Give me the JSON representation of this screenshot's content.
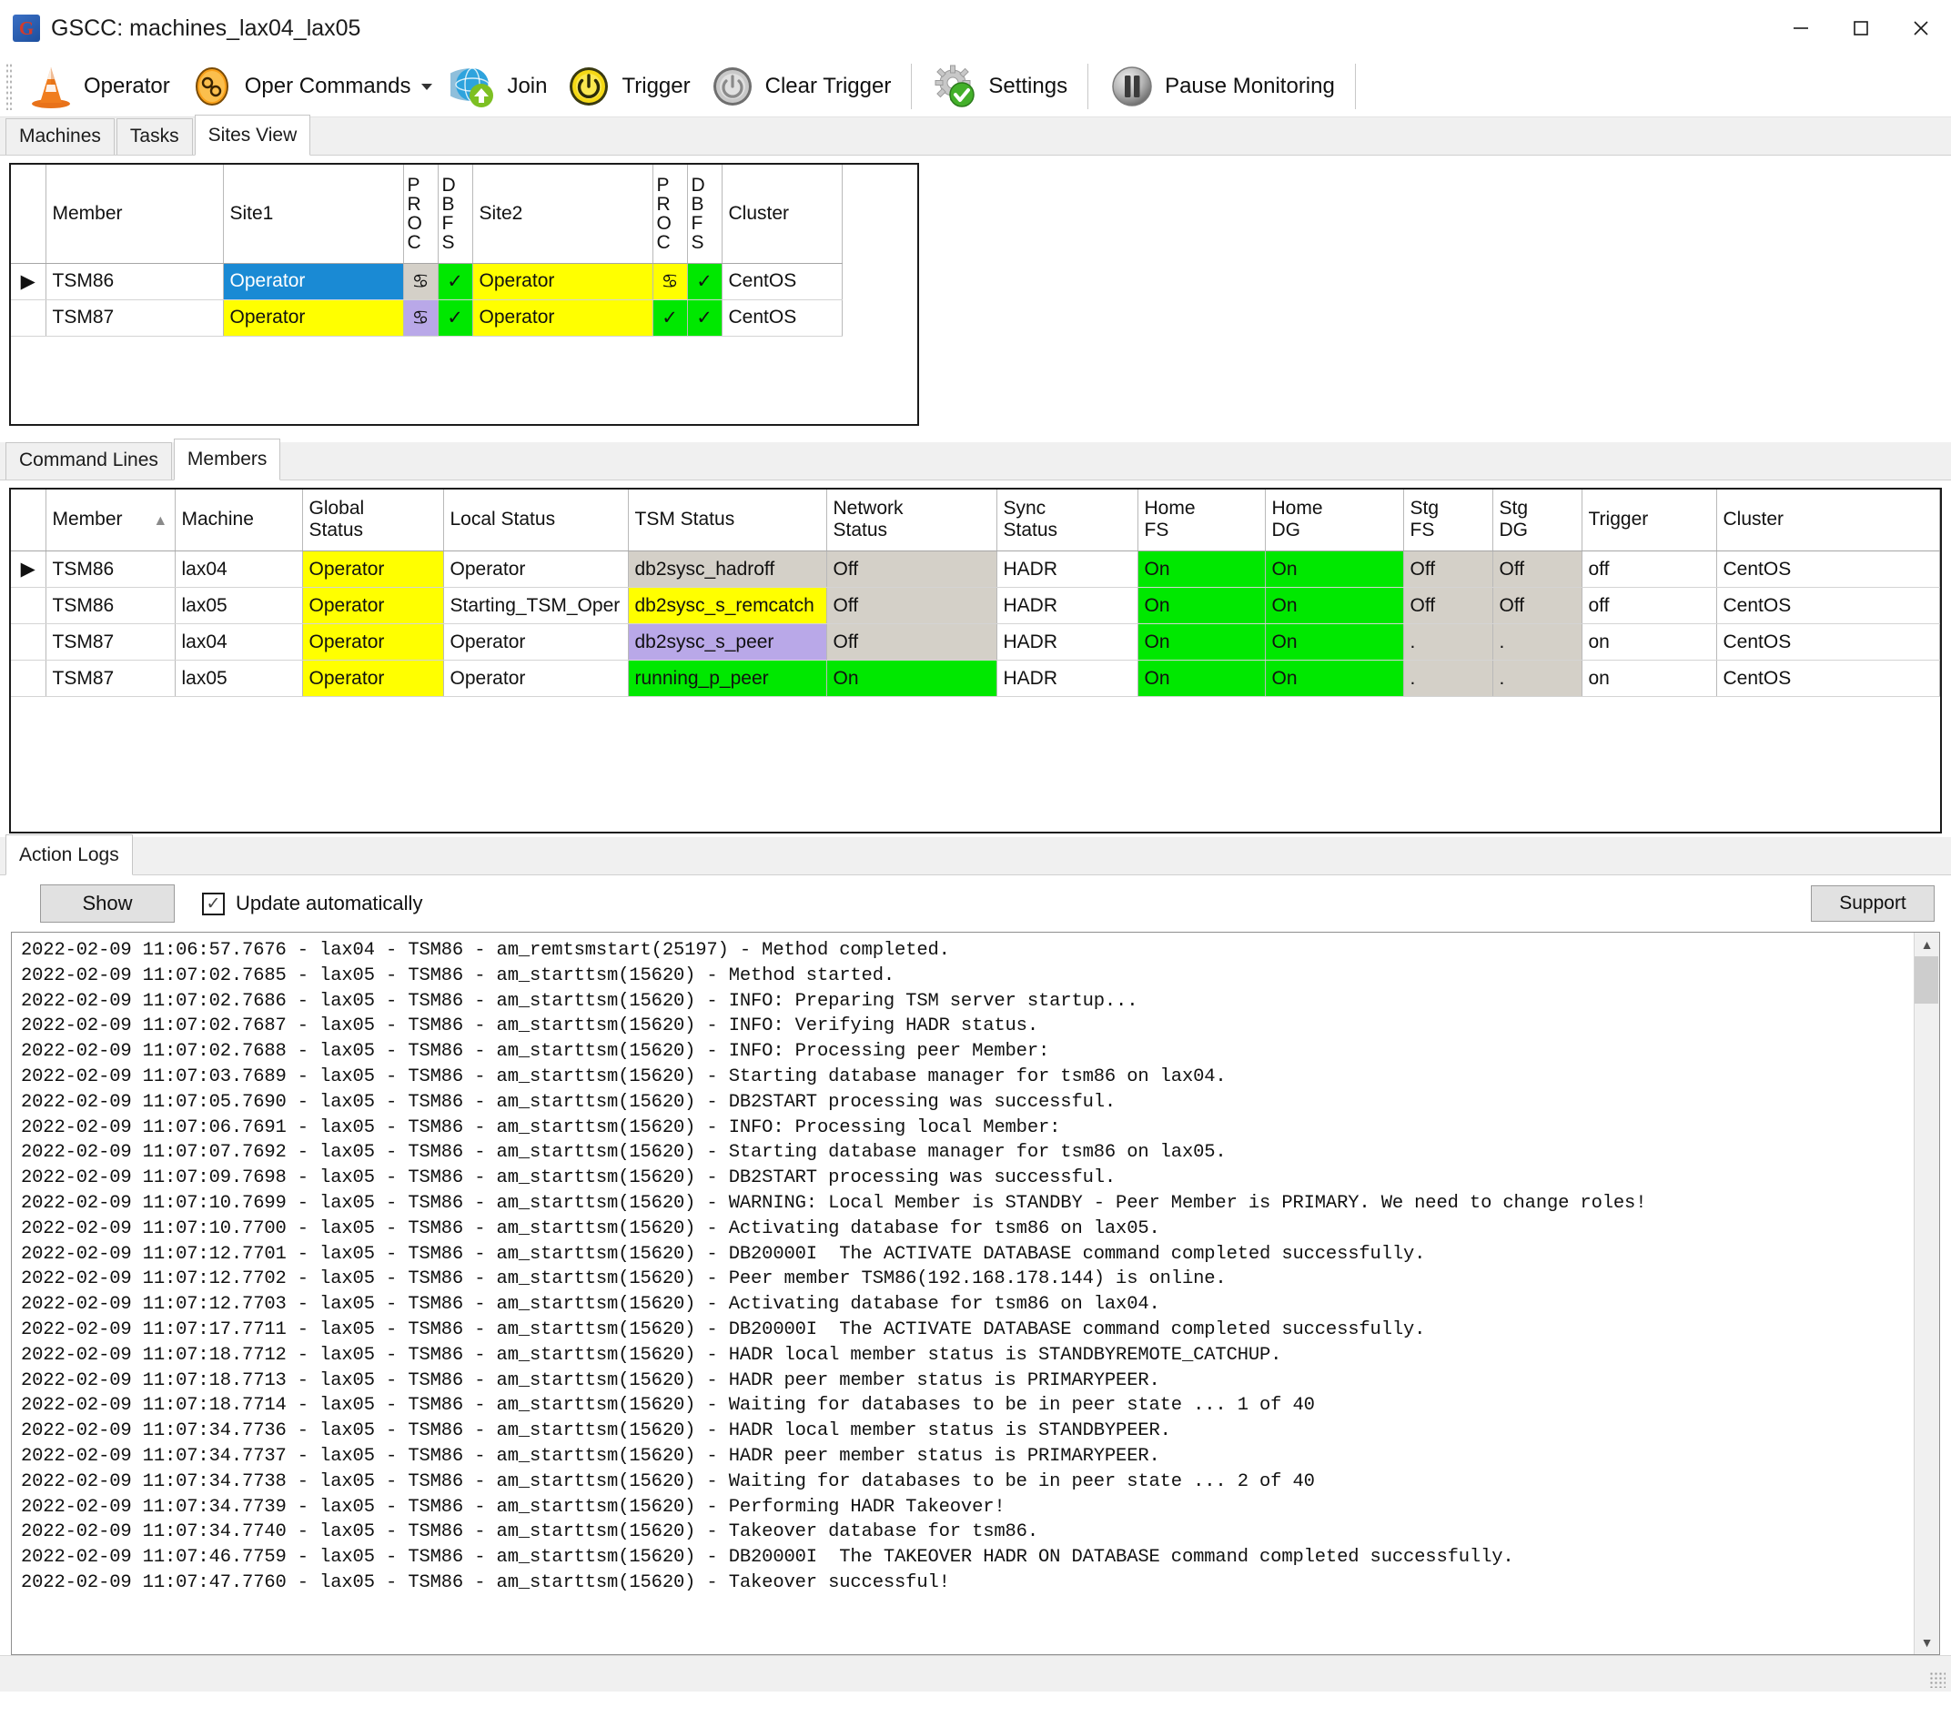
{
  "window": {
    "title": "GSCC: machines_lax04_lax05",
    "app_icon": "G",
    "minimize": "minimize-icon",
    "maximize": "maximize-icon",
    "close": "close-icon"
  },
  "toolbar": {
    "items": [
      {
        "label": "Operator",
        "icon": "traffic-cone-icon",
        "dropdown": false
      },
      {
        "label": "Oper Commands",
        "icon": "gear-links-icon",
        "dropdown": true
      },
      {
        "label": "Join",
        "icon": "globe-join-icon",
        "dropdown": false
      },
      {
        "label": "Trigger",
        "icon": "power-yellow-icon",
        "dropdown": false
      },
      {
        "label": "Clear Trigger",
        "icon": "power-gray-icon",
        "dropdown": false
      },
      {
        "label": "Settings",
        "icon": "gear-check-icon",
        "dropdown": false
      },
      {
        "label": "Pause Monitoring",
        "icon": "pause-icon",
        "dropdown": false
      }
    ]
  },
  "top_tabs": {
    "items": [
      "Machines",
      "Tasks",
      "Sites View"
    ],
    "active": "Sites View"
  },
  "sites_grid": {
    "columns": [
      "",
      "Member",
      "Site1",
      "PROC",
      "DBFS",
      "Site2",
      "PROC",
      "DBFS",
      "Cluster"
    ],
    "vertical_headers": {
      "proc": "PROC",
      "dbfs": "DBFS"
    },
    "rows": [
      {
        "selector": "▶",
        "member": "TSM86",
        "site1": "Operator",
        "site1_color": "#1a8ad4",
        "site1_proc": "♋",
        "site1_proc_color": "#d4d0c8",
        "site1_dbfs": "✓",
        "site1_dbfs_color": "#00e800",
        "site2": "Operator",
        "site2_color": "#ffff00",
        "site2_proc": "♋",
        "site2_proc_color": "#ffff00",
        "site2_dbfs": "✓",
        "site2_dbfs_color": "#00e800",
        "cluster": "CentOS"
      },
      {
        "selector": "",
        "member": "TSM87",
        "site1": "Operator",
        "site1_color": "#ffff00",
        "site1_proc": "♋",
        "site1_proc_color": "#b9a8e8",
        "site1_dbfs": "✓",
        "site1_dbfs_color": "#00e800",
        "site2": "Operator",
        "site2_color": "#ffff00",
        "site2_proc": "✓",
        "site2_proc_color": "#00e800",
        "site2_dbfs": "✓",
        "site2_dbfs_color": "#00e800",
        "cluster": "CentOS"
      }
    ]
  },
  "middle_tabs": {
    "items": [
      "Command Lines",
      "Members"
    ],
    "active": "Members"
  },
  "members_grid": {
    "columns": [
      "",
      "Member",
      "Machine",
      "Global Status",
      "Local Status",
      "TSM Status",
      "Network Status",
      "Sync Status",
      "Home FS",
      "Home DG",
      "Stg FS",
      "Stg DG",
      "Trigger",
      "Cluster"
    ],
    "sort_column": "Member",
    "sort_direction": "ascending",
    "rows": [
      {
        "selector": "▶",
        "member": "TSM86",
        "machine": "lax04",
        "global_status": "Operator",
        "global_color": "#ffff00",
        "local_status": "Operator",
        "local_color": "#ffffff",
        "tsm_status": "db2sysc_hadroff",
        "tsm_color": "#d4d0c8",
        "network_status": "Off",
        "network_color": "#d4d0c8",
        "sync_status": "HADR",
        "sync_color": "#ffffff",
        "home_fs": "On",
        "home_fs_color": "#00e800",
        "home_dg": "On",
        "home_dg_color": "#00e800",
        "stg_fs": "Off",
        "stg_fs_color": "#d4d0c8",
        "stg_dg": "Off",
        "stg_dg_color": "#d4d0c8",
        "trigger": "off",
        "trigger_color": "#ffffff",
        "cluster": "CentOS"
      },
      {
        "selector": "",
        "member": "TSM86",
        "machine": "lax05",
        "global_status": "Operator",
        "global_color": "#ffff00",
        "local_status": "Starting_TSM_Oper",
        "local_color": "#ffffff",
        "tsm_status": "db2sysc_s_remcatch",
        "tsm_color": "#ffff00",
        "network_status": "Off",
        "network_color": "#d4d0c8",
        "sync_status": "HADR",
        "sync_color": "#ffffff",
        "home_fs": "On",
        "home_fs_color": "#00e800",
        "home_dg": "On",
        "home_dg_color": "#00e800",
        "stg_fs": "Off",
        "stg_fs_color": "#d4d0c8",
        "stg_dg": "Off",
        "stg_dg_color": "#d4d0c8",
        "trigger": "off",
        "trigger_color": "#ffffff",
        "cluster": "CentOS"
      },
      {
        "selector": "",
        "member": "TSM87",
        "machine": "lax04",
        "global_status": "Operator",
        "global_color": "#ffff00",
        "local_status": "Operator",
        "local_color": "#ffffff",
        "tsm_status": "db2sysc_s_peer",
        "tsm_color": "#b9a8e8",
        "network_status": "Off",
        "network_color": "#d4d0c8",
        "sync_status": "HADR",
        "sync_color": "#ffffff",
        "home_fs": "On",
        "home_fs_color": "#00e800",
        "home_dg": "On",
        "home_dg_color": "#00e800",
        "stg_fs": ".",
        "stg_fs_color": "#d4d0c8",
        "stg_dg": ".",
        "stg_dg_color": "#d4d0c8",
        "trigger": "on",
        "trigger_color": "#ffffff",
        "cluster": "CentOS"
      },
      {
        "selector": "",
        "member": "TSM87",
        "machine": "lax05",
        "global_status": "Operator",
        "global_color": "#ffff00",
        "local_status": "Operator",
        "local_color": "#ffffff",
        "tsm_status": "running_p_peer",
        "tsm_color": "#00e800",
        "network_status": "On",
        "network_color": "#00e800",
        "sync_status": "HADR",
        "sync_color": "#ffffff",
        "home_fs": "On",
        "home_fs_color": "#00e800",
        "home_dg": "On",
        "home_dg_color": "#00e800",
        "stg_fs": ".",
        "stg_fs_color": "#d4d0c8",
        "stg_dg": ".",
        "stg_dg_color": "#d4d0c8",
        "trigger": "on",
        "trigger_color": "#ffffff",
        "cluster": "CentOS"
      }
    ]
  },
  "logs_tab": {
    "items": [
      "Action Logs"
    ],
    "active": "Action Logs"
  },
  "log_controls": {
    "show_label": "Show",
    "auto_update_label": "Update automatically",
    "auto_update_checked": true,
    "checkmark": "✓",
    "support_label": "Support"
  },
  "log_text": "2022-02-09 11:06:57.7676 - lax04 - TSM86 - am_remtsmstart(25197) - Method completed.\n2022-02-09 11:07:02.7685 - lax05 - TSM86 - am_starttsm(15620) - Method started.\n2022-02-09 11:07:02.7686 - lax05 - TSM86 - am_starttsm(15620) - INFO: Preparing TSM server startup...\n2022-02-09 11:07:02.7687 - lax05 - TSM86 - am_starttsm(15620) - INFO: Verifying HADR status.\n2022-02-09 11:07:02.7688 - lax05 - TSM86 - am_starttsm(15620) - INFO: Processing peer Member:\n2022-02-09 11:07:03.7689 - lax05 - TSM86 - am_starttsm(15620) - Starting database manager for tsm86 on lax04.\n2022-02-09 11:07:05.7690 - lax05 - TSM86 - am_starttsm(15620) - DB2START processing was successful.\n2022-02-09 11:07:06.7691 - lax05 - TSM86 - am_starttsm(15620) - INFO: Processing local Member:\n2022-02-09 11:07:07.7692 - lax05 - TSM86 - am_starttsm(15620) - Starting database manager for tsm86 on lax05.\n2022-02-09 11:07:09.7698 - lax05 - TSM86 - am_starttsm(15620) - DB2START processing was successful.\n2022-02-09 11:07:10.7699 - lax05 - TSM86 - am_starttsm(15620) - WARNING: Local Member is STANDBY - Peer Member is PRIMARY. We need to change roles!\n2022-02-09 11:07:10.7700 - lax05 - TSM86 - am_starttsm(15620) - Activating database for tsm86 on lax05.\n2022-02-09 11:07:12.7701 - lax05 - TSM86 - am_starttsm(15620) - DB20000I  The ACTIVATE DATABASE command completed successfully.\n2022-02-09 11:07:12.7702 - lax05 - TSM86 - am_starttsm(15620) - Peer member TSM86(192.168.178.144) is online.\n2022-02-09 11:07:12.7703 - lax05 - TSM86 - am_starttsm(15620) - Activating database for tsm86 on lax04.\n2022-02-09 11:07:17.7711 - lax05 - TSM86 - am_starttsm(15620) - DB20000I  The ACTIVATE DATABASE command completed successfully.\n2022-02-09 11:07:18.7712 - lax05 - TSM86 - am_starttsm(15620) - HADR local member status is STANDBYREMOTE_CATCHUP.\n2022-02-09 11:07:18.7713 - lax05 - TSM86 - am_starttsm(15620) - HADR peer member status is PRIMARYPEER.\n2022-02-09 11:07:18.7714 - lax05 - TSM86 - am_starttsm(15620) - Waiting for databases to be in peer state ... 1 of 40\n2022-02-09 11:07:34.7736 - lax05 - TSM86 - am_starttsm(15620) - HADR local member status is STANDBYPEER.\n2022-02-09 11:07:34.7737 - lax05 - TSM86 - am_starttsm(15620) - HADR peer member status is PRIMARYPEER.\n2022-02-09 11:07:34.7738 - lax05 - TSM86 - am_starttsm(15620) - Waiting for databases to be in peer state ... 2 of 40\n2022-02-09 11:07:34.7739 - lax05 - TSM86 - am_starttsm(15620) - Performing HADR Takeover!\n2022-02-09 11:07:34.7740 - lax05 - TSM86 - am_starttsm(15620) - Takeover database for tsm86.\n2022-02-09 11:07:46.7759 - lax05 - TSM86 - am_starttsm(15620) - DB20000I  The TAKEOVER HADR ON DATABASE command completed successfully.\n2022-02-09 11:07:47.7760 - lax05 - TSM86 - am_starttsm(15620) - Takeover successful!",
  "scrollbar": {
    "up_arrow": "▲",
    "down_arrow": "▼"
  }
}
